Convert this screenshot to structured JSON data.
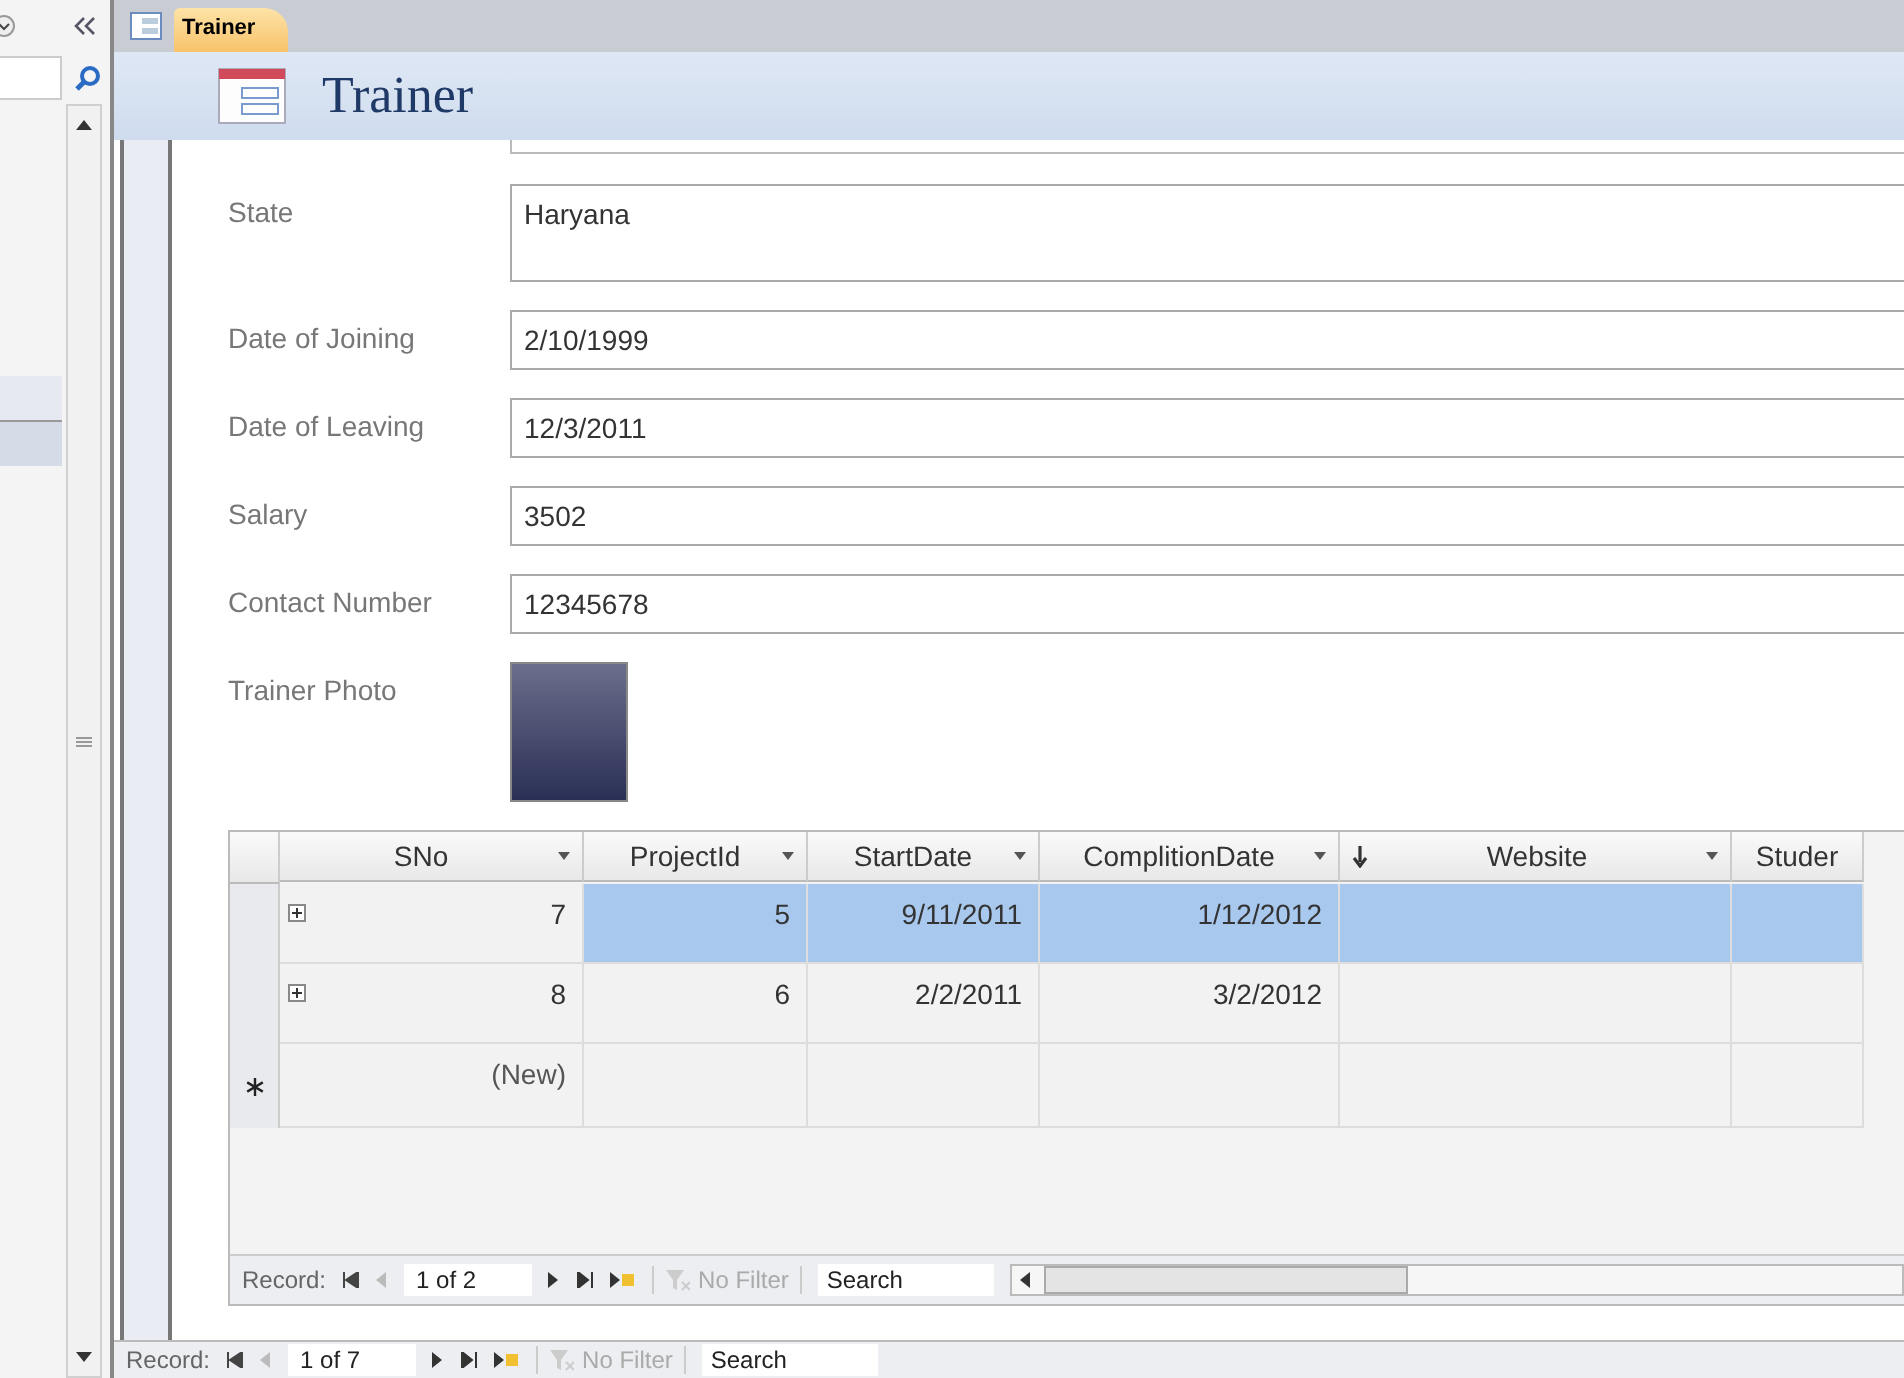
{
  "tabs": [
    {
      "label": "Trainer",
      "selected": true
    }
  ],
  "form_header": {
    "title": "Trainer"
  },
  "fields": [
    {
      "label": "State",
      "value": "Haryana",
      "kind": "memo"
    },
    {
      "label": "Date of Joining",
      "value": "2/10/1999",
      "kind": "text"
    },
    {
      "label": "Date of Leaving",
      "value": "12/3/2011",
      "kind": "text"
    },
    {
      "label": "Salary",
      "value": "3502",
      "kind": "text"
    },
    {
      "label": "Contact Number",
      "value": "12345678",
      "kind": "text"
    },
    {
      "label": "Trainer Photo",
      "kind": "photo"
    }
  ],
  "subform": {
    "columns": [
      {
        "label": "SNo",
        "sorted": false
      },
      {
        "label": "ProjectId",
        "sorted": false
      },
      {
        "label": "StartDate",
        "sorted": false
      },
      {
        "label": "ComplitionDate",
        "sorted": false
      },
      {
        "label": "Website",
        "sorted": true
      },
      {
        "label": "Studer",
        "sorted": false
      }
    ],
    "rows": [
      {
        "cells": [
          "7",
          "5",
          "9/11/2011",
          "1/12/2012",
          "",
          ""
        ],
        "selected": true
      },
      {
        "cells": [
          "8",
          "6",
          "2/2/2011",
          "3/2/2012",
          "",
          ""
        ],
        "selected": false
      }
    ],
    "new_row": "(New)",
    "record_nav": {
      "label": "Record:",
      "position": "1 of 2",
      "filter": "No Filter",
      "search_placeholder": "Search"
    }
  },
  "record_nav": {
    "label": "Record:",
    "position": "1 of 7",
    "filter": "No Filter",
    "search_placeholder": "Search"
  }
}
